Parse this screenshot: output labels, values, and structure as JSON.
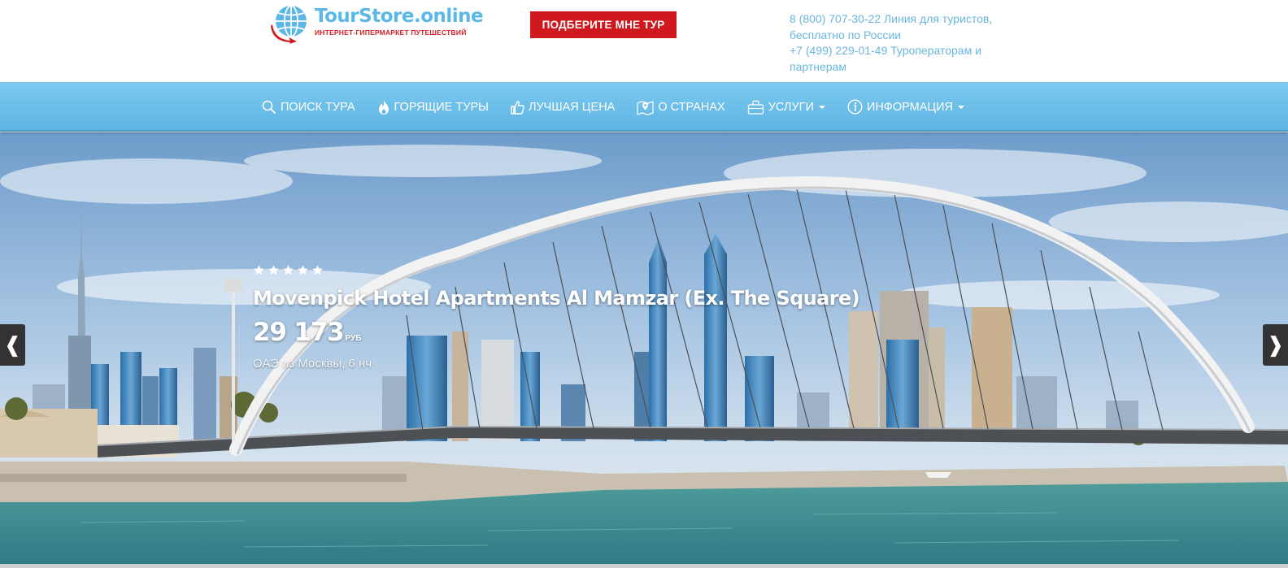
{
  "header": {
    "logo": {
      "name": "TourStore.online",
      "tagline": "интернет-гипермаркет путешествий"
    },
    "cta_button": "ПОДБЕРИТЕ МНЕ ТУР",
    "contacts": {
      "line1": "8 (800) 707-30-22 Линия для туристов,",
      "line2": "бесплатно по России",
      "line3": "+7 (499) 229-01-49 Туроператорам и",
      "line4": "партнерам"
    }
  },
  "nav": {
    "items": [
      {
        "label": "ПОИСК ТУРА",
        "icon": "search-icon"
      },
      {
        "label": "ГОРЯЩИЕ ТУРЫ",
        "icon": "fire-icon"
      },
      {
        "label": "ЛУЧШАЯ ЦЕНА",
        "icon": "thumbs-up-icon"
      },
      {
        "label": "О СТРАНАХ",
        "icon": "map-pin-icon"
      },
      {
        "label": "УСЛУГИ",
        "icon": "suitcase-icon",
        "dropdown": true
      },
      {
        "label": "ИНФОРМАЦИЯ",
        "icon": "info-icon",
        "dropdown": true
      }
    ]
  },
  "slider": {
    "stars": 5,
    "hotel_name": "Movenpick Hotel Apartments Al Mamzar (Ex. The Square)",
    "price": "29 173",
    "currency": "руб",
    "subline": "ОАЭ из Москвы, 6 нч",
    "prev_arrow": "❰",
    "next_arrow": "❱"
  },
  "colors": {
    "brand_blue": "#5bb8e6",
    "brand_red": "#d0191f",
    "nav_top": "#7ccaf0",
    "nav_bottom": "#5eb4e2",
    "contact_text": "#6ab6e0"
  }
}
